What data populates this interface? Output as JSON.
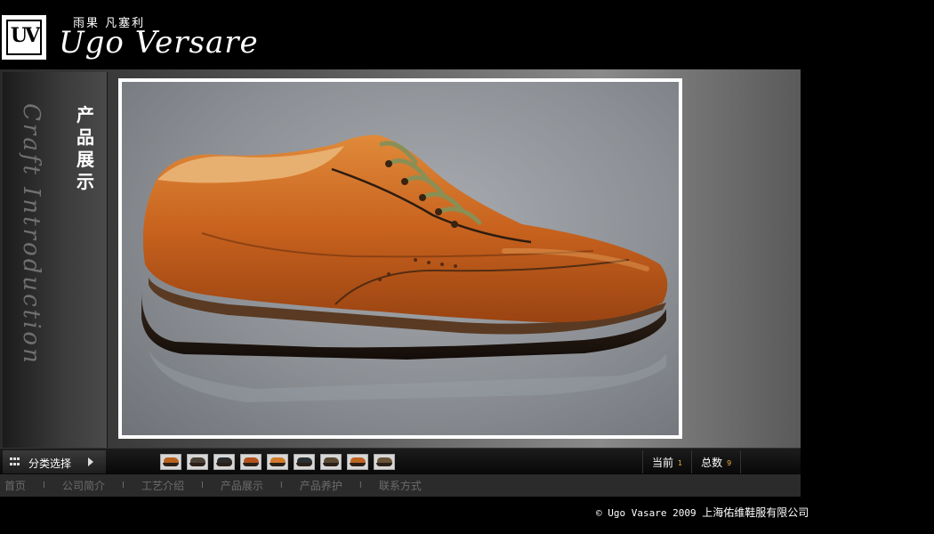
{
  "header": {
    "logo_letters": "UV",
    "brand_cn": "雨果 凡塞利",
    "brand_en": "Ugo Versare"
  },
  "left_panel": {
    "section_title": "产品展示",
    "script_text": "Craft Introduction"
  },
  "product_photo": {
    "subject": "shoe-image",
    "colors": {
      "leather": "#c8621e",
      "laces": "#8a8f55",
      "sole": "#2a1c14"
    }
  },
  "thumbbar": {
    "category_label": "分类选择",
    "thumbnails": [
      {
        "color": "#b8621f"
      },
      {
        "color": "#4a4236"
      },
      {
        "color": "#2b2b2b"
      },
      {
        "color": "#b5521e"
      },
      {
        "color": "#d27a2a"
      },
      {
        "color": "#2a2f33"
      },
      {
        "color": "#5a4a34"
      },
      {
        "color": "#c06422"
      },
      {
        "color": "#6a5438"
      }
    ],
    "current_label": "当前",
    "current_value": "1",
    "total_label": "总数",
    "total_value": "9"
  },
  "nav": {
    "items": [
      "首页",
      "公司简介",
      "工艺介绍",
      "产品展示",
      "产品养护",
      "联系方式"
    ],
    "separator": "I"
  },
  "footer": {
    "copyright": "© Ugo Vasare 2009",
    "company": "上海佑维鞋服有限公司"
  }
}
